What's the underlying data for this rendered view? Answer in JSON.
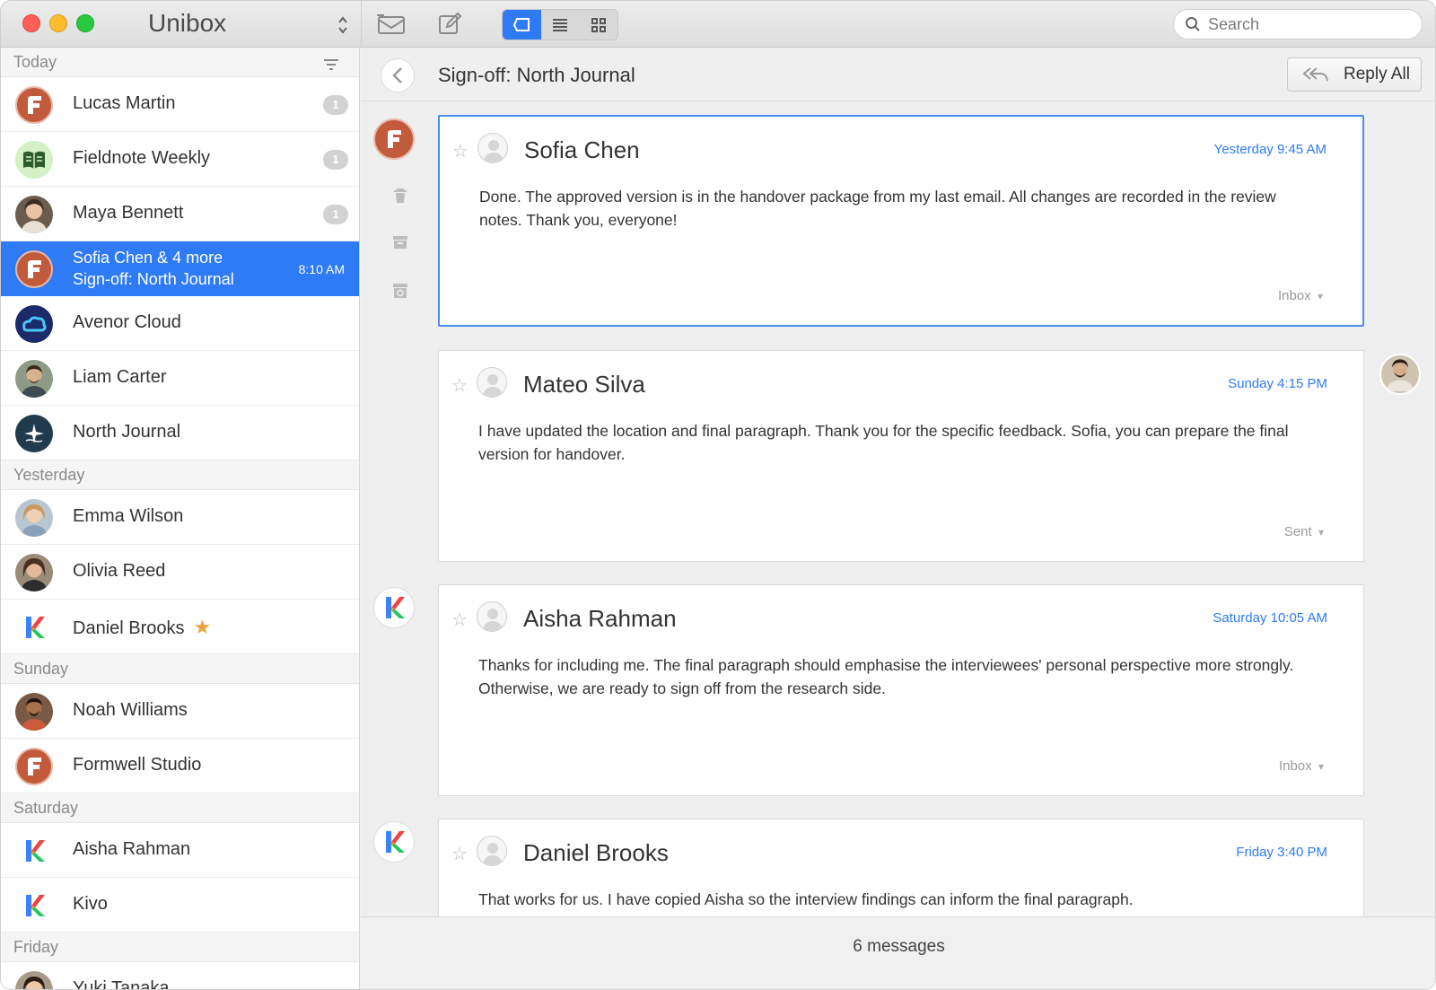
{
  "app": {
    "title": "Unibox"
  },
  "search": {
    "placeholder": "Search"
  },
  "sidebar": {
    "sections": [
      {
        "label": "Today"
      },
      {
        "label": "Yesterday"
      },
      {
        "label": "Sunday"
      },
      {
        "label": "Saturday"
      },
      {
        "label": "Friday"
      }
    ],
    "today": [
      {
        "name": "Lucas Martin",
        "badge": "1"
      },
      {
        "name": "Fieldnote Weekly",
        "badge": "1"
      },
      {
        "name": "Maya Bennett",
        "badge": "1"
      },
      {
        "name": "Sofia Chen & 4 more",
        "subject": "Sign-off: North Journal",
        "time": "8:10 AM"
      },
      {
        "name": "Avenor Cloud"
      },
      {
        "name": "Liam Carter"
      },
      {
        "name": "North Journal"
      }
    ],
    "yesterday": [
      {
        "name": "Emma Wilson"
      },
      {
        "name": "Olivia Reed"
      },
      {
        "name": "Daniel Brooks",
        "starred": "★"
      }
    ],
    "sunday": [
      {
        "name": "Noah Williams"
      },
      {
        "name": "Formwell Studio"
      }
    ],
    "saturday": [
      {
        "name": "Aisha Rahman"
      },
      {
        "name": "Kivo"
      }
    ],
    "friday": [
      {
        "name": "Yuki Tanaka"
      }
    ]
  },
  "thread": {
    "title": "Sign-off: North Journal",
    "reply_all_label": "Reply All",
    "messages": [
      {
        "from": "Sofia Chen",
        "time": "Yesterday 9:45 AM",
        "body": "Done. The approved version is in the handover package from my last email. All changes are recorded in the review notes. Thank you, everyone!",
        "folder": "Inbox"
      },
      {
        "from": "Mateo Silva",
        "time": "Sunday 4:15 PM",
        "body": "I have updated the location and final paragraph. Thank you for the specific feedback. Sofia, you can prepare the final version for handover.",
        "folder": "Sent"
      },
      {
        "from": "Aisha Rahman",
        "time": "Saturday 10:05 AM",
        "body": "Thanks for including me. The final paragraph should emphasise the interviewees' personal perspective more strongly. Otherwise, we are ready to sign off from the research side.",
        "folder": "Inbox"
      },
      {
        "from": "Daniel Brooks",
        "time": "Friday 3:40 PM",
        "body": "That works for us. I have copied Aisha so the interview findings can inform the final paragraph."
      }
    ],
    "footer_count": "6 messages"
  },
  "colors": {
    "accent": "#2f7bf5",
    "selected_row": "#2f7bf5",
    "formwell_brand": "#c25a3c"
  }
}
